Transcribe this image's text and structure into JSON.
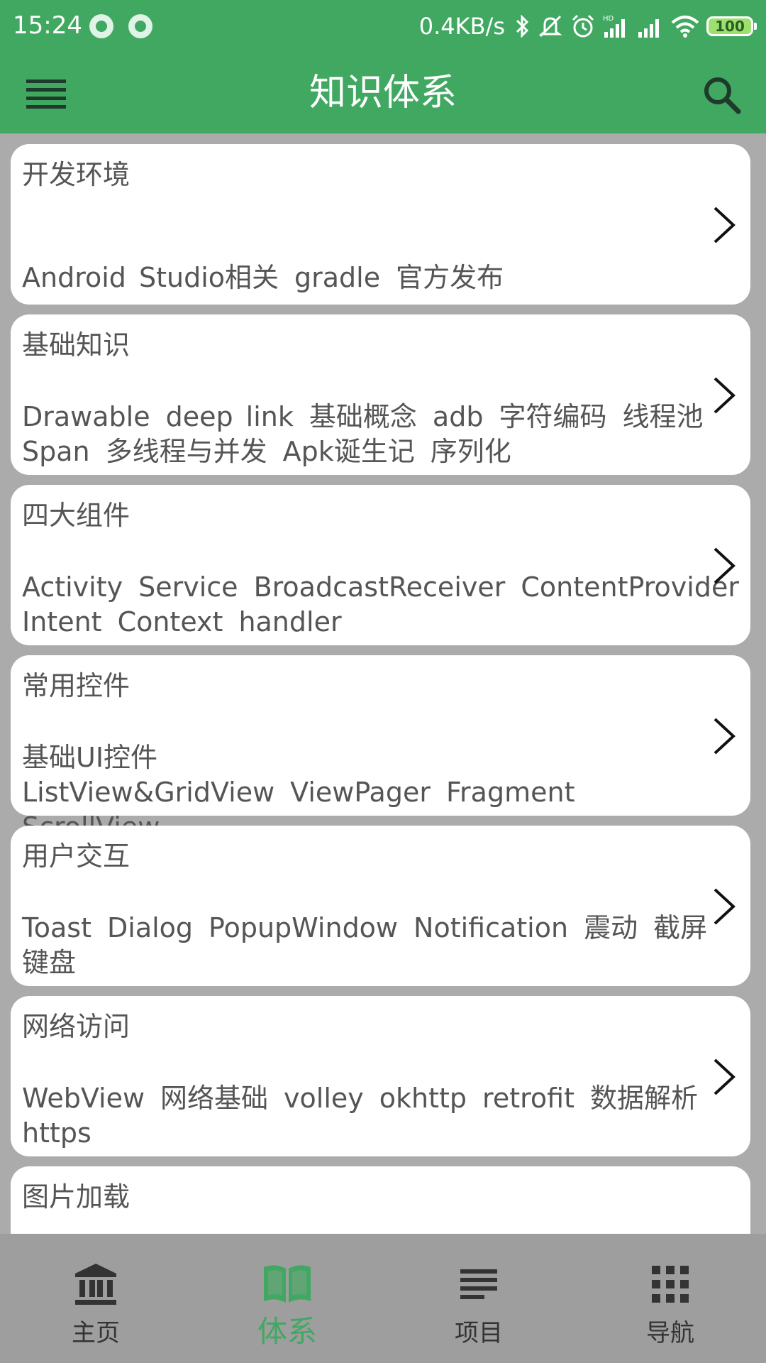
{
  "colors": {
    "primary": "#41a862",
    "background": "#ababab",
    "card": "#ffffff",
    "text": "#555555",
    "nav_background": "#9e9e9e",
    "nav_active": "#41a862",
    "nav_inactive": "#333333"
  },
  "status_bar": {
    "time": "15:24",
    "network_speed": "0.4KB/s",
    "battery": "100",
    "icons": [
      "notification-dot-icon",
      "notification-dot-icon",
      "bluetooth-icon",
      "mute-icon",
      "alarm-icon",
      "hd-signal-icon",
      "signal-icon",
      "wifi-icon",
      "battery-icon"
    ]
  },
  "app_bar": {
    "title": "知识体系",
    "menu_icon": "menu-icon",
    "search_icon": "search-icon"
  },
  "categories": [
    {
      "title": "开发环境",
      "tag_lines": [
        [
          "Android Studio相关",
          "gradle",
          "官方发布"
        ]
      ]
    },
    {
      "title": "基础知识",
      "tag_lines": [
        [
          "Drawable",
          "deep link",
          "基础概念",
          "adb",
          "字符编码",
          "线程池"
        ],
        [
          "Span",
          "多线程与并发",
          "Apk诞生记",
          "序列化"
        ]
      ]
    },
    {
      "title": "四大组件",
      "tag_lines": [
        [
          "Activity",
          "Service",
          "BroadcastReceiver",
          "ContentProvider"
        ],
        [
          "Intent",
          "Context",
          "handler"
        ]
      ]
    },
    {
      "title": "常用控件",
      "tag_lines": [
        [
          "基础UI控件",
          "ListView&GridView",
          "ViewPager",
          "Fragment"
        ],
        [
          "ScrollView"
        ]
      ]
    },
    {
      "title": "用户交互",
      "tag_lines": [
        [
          "Toast",
          "Dialog",
          "PopupWindow",
          "Notification",
          "震动",
          "截屏"
        ],
        [
          "键盘"
        ]
      ]
    },
    {
      "title": "网络访问",
      "tag_lines": [
        [
          "WebView",
          "网络基础",
          "volley",
          "okhttp",
          "retrofit",
          "数据解析"
        ],
        [
          "https"
        ]
      ]
    },
    {
      "title": "图片加载",
      "tag_lines": []
    }
  ],
  "bottom_nav": {
    "items": [
      {
        "label": "主页",
        "icon": "bank-icon",
        "active": false
      },
      {
        "label": "体系",
        "icon": "book-icon",
        "active": true
      },
      {
        "label": "项目",
        "icon": "list-lines-icon",
        "active": false
      },
      {
        "label": "导航",
        "icon": "grid-icon",
        "active": false
      }
    ]
  }
}
